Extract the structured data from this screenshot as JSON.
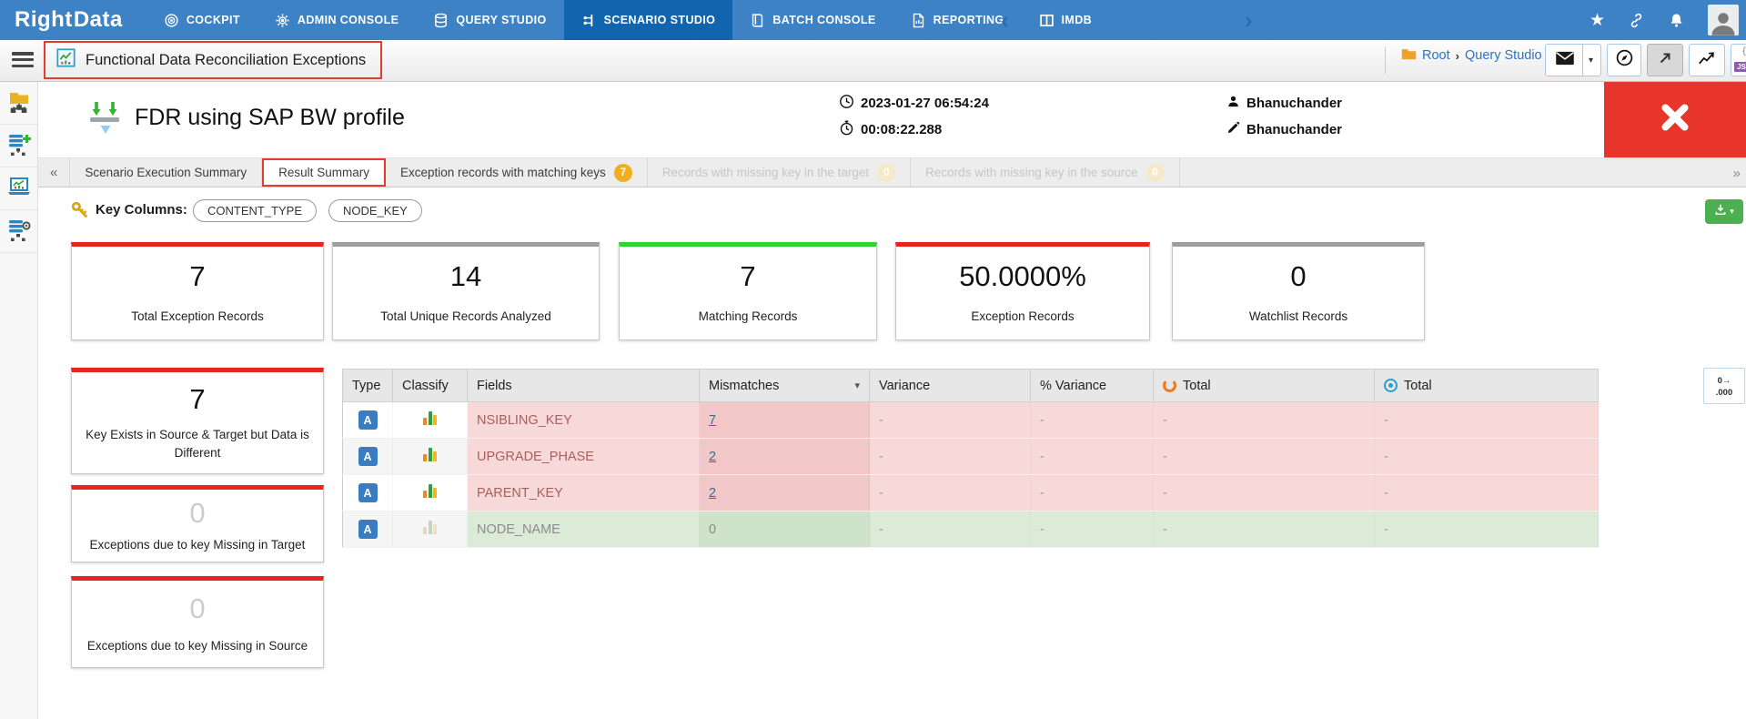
{
  "nav": {
    "logo_part1": "Right",
    "logo_part2": "Data",
    "items": [
      {
        "label": "COCKPIT"
      },
      {
        "label": "ADMIN CONSOLE"
      },
      {
        "label": "QUERY STUDIO"
      },
      {
        "label": "SCENARIO STUDIO"
      },
      {
        "label": "BATCH CONSOLE"
      },
      {
        "label": "REPORTING"
      },
      {
        "label": "IMDB"
      }
    ]
  },
  "toolbar": {
    "title": "Functional Data Reconciliation Exceptions",
    "breadcrumb": {
      "root": "Root",
      "separator": "›",
      "current": "Query Studio"
    },
    "json_button": {
      "glyph": "{;}",
      "label": "JSON"
    }
  },
  "header": {
    "profile_name": "FDR using SAP BW profile",
    "execution_datetime": "2023-01-27 06:54:24",
    "execution_duration": "00:08:22.288",
    "created_by": "Bhanuchander",
    "modified_by": "Bhanuchander"
  },
  "tabs": [
    {
      "label": "Scenario Execution Summary"
    },
    {
      "label": "Result Summary"
    },
    {
      "label": "Exception records with matching keys",
      "badge": "7"
    },
    {
      "label": "Records with missing key in the target",
      "badge": "0"
    },
    {
      "label": "Records with missing key in the source",
      "badge": "0"
    }
  ],
  "key_columns": {
    "label": "Key Columns:",
    "pills": [
      "CONTENT_TYPE",
      "NODE_KEY"
    ]
  },
  "summary_cards": [
    {
      "value": "7",
      "label": "Total Exception Records",
      "accent": "#e8251d"
    },
    {
      "value": "14",
      "label": "Total Unique Records Analyzed",
      "accent": "#9e9e9e"
    },
    {
      "value": "7",
      "label": "Matching Records",
      "accent": "#2fd32f"
    },
    {
      "value": "50.0000%",
      "label": "Exception Records",
      "accent": "#e8251d"
    },
    {
      "value": "0",
      "label": "Watchlist Records",
      "accent": "#9e9e9e"
    }
  ],
  "breakdown_cards": [
    {
      "value": "7",
      "label": "Key Exists in Source & Target but Data is Different",
      "accent": "#e8251d"
    },
    {
      "value": "0",
      "label": "Exceptions due to key Missing in Target",
      "accent": "#e8251d"
    },
    {
      "value": "0",
      "label": "Exceptions due to key Missing in Source",
      "accent": "#e8251d"
    }
  ],
  "table": {
    "columns": [
      "Type",
      "Classify",
      "Fields",
      "Mismatches",
      "Variance",
      "% Variance",
      "Total",
      "Total"
    ],
    "rows": [
      {
        "type": "A",
        "field": "NSIBLING_KEY",
        "mismatches": "7",
        "variance": "-",
        "pct_variance": "-",
        "source_total": "-",
        "target_total": "-"
      },
      {
        "type": "A",
        "field": "UPGRADE_PHASE",
        "mismatches": "2",
        "variance": "-",
        "pct_variance": "-",
        "source_total": "-",
        "target_total": "-"
      },
      {
        "type": "A",
        "field": "PARENT_KEY",
        "mismatches": "2",
        "variance": "-",
        "pct_variance": "-",
        "source_total": "-",
        "target_total": "-"
      },
      {
        "type": "A",
        "field": "NODE_NAME",
        "mismatches": "0",
        "variance": "-",
        "pct_variance": "-",
        "source_total": "-",
        "target_total": "-"
      }
    ]
  },
  "format_button": {
    "top": "0→",
    "bottom": ".000"
  },
  "icons": {
    "collapse_tabs": "«",
    "more_tabs": "»",
    "nav_prev": "‹",
    "nav_next": "›",
    "sort_desc": "▾",
    "dropdown": "▾",
    "star": "★"
  },
  "colors": {
    "nav_bg": "#3d82c4",
    "nav_active": "#1165ae",
    "annotation_red": "#e23b30",
    "close_button": "#e8352b",
    "exception_row": "#f8d9d9",
    "match_row": "#dcead8",
    "badge_yellow": "#efae1d",
    "download_green": "#4cb050"
  }
}
